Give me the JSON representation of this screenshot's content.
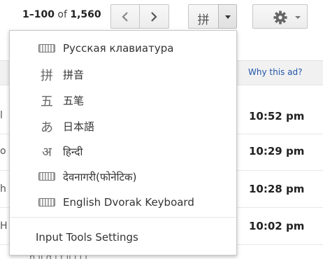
{
  "toolbar": {
    "range": "1–100",
    "of": "of",
    "total": "1,560",
    "ime_current": "拼"
  },
  "ime_menu": {
    "items": [
      {
        "label": "Русская клавиатура",
        "icon": "keyboard-icon"
      },
      {
        "label": "拼音",
        "glyph": "拼"
      },
      {
        "label": "五笔",
        "glyph": "五"
      },
      {
        "label": "日本語",
        "glyph": "あ"
      },
      {
        "label": "हिन्दी",
        "glyph": "अ"
      },
      {
        "label": "देवनागरी(फोनेटिक)",
        "icon": "keyboard-icon"
      },
      {
        "label": "English Dvorak Keyboard",
        "icon": "keyboard-icon"
      }
    ],
    "settings_label": "Input Tools Settings"
  },
  "mail_list": {
    "why_ad": "Why this ad?",
    "rows": [
      {
        "fragment": "l",
        "time": "10:52 pm"
      },
      {
        "fragment": "o",
        "time": "10:29 pm"
      },
      {
        "fragment": "h",
        "time": "10:28 pm"
      },
      {
        "fragment": "H",
        "time": "10:02 pm"
      }
    ],
    "bottom_fragment": "h ll d l f ll l l l"
  }
}
